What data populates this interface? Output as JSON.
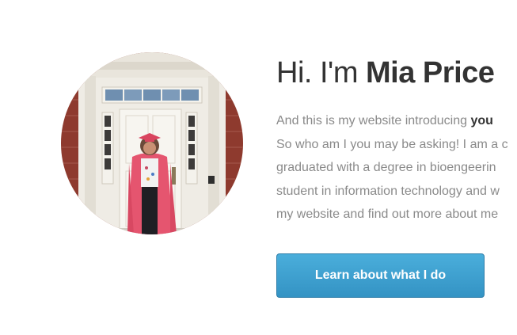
{
  "hero": {
    "greeting": "Hi. I'm",
    "name": "Mia Price",
    "intro_lines": [
      {
        "before": "And this is my website introducing ",
        "emph": "you"
      },
      {
        "before": "So who am I you may be asking! I am a c"
      },
      {
        "before": "graduated with a degree in bioengeerin"
      },
      {
        "before": "student in information technology and w"
      },
      {
        "before": "my website and find out more about me"
      }
    ],
    "cta_label": "Learn about what I do"
  },
  "colors": {
    "cta_start": "#4aaedb",
    "cta_end": "#3493c4",
    "heading": "#333333",
    "body_text": "#8a8a8a"
  }
}
